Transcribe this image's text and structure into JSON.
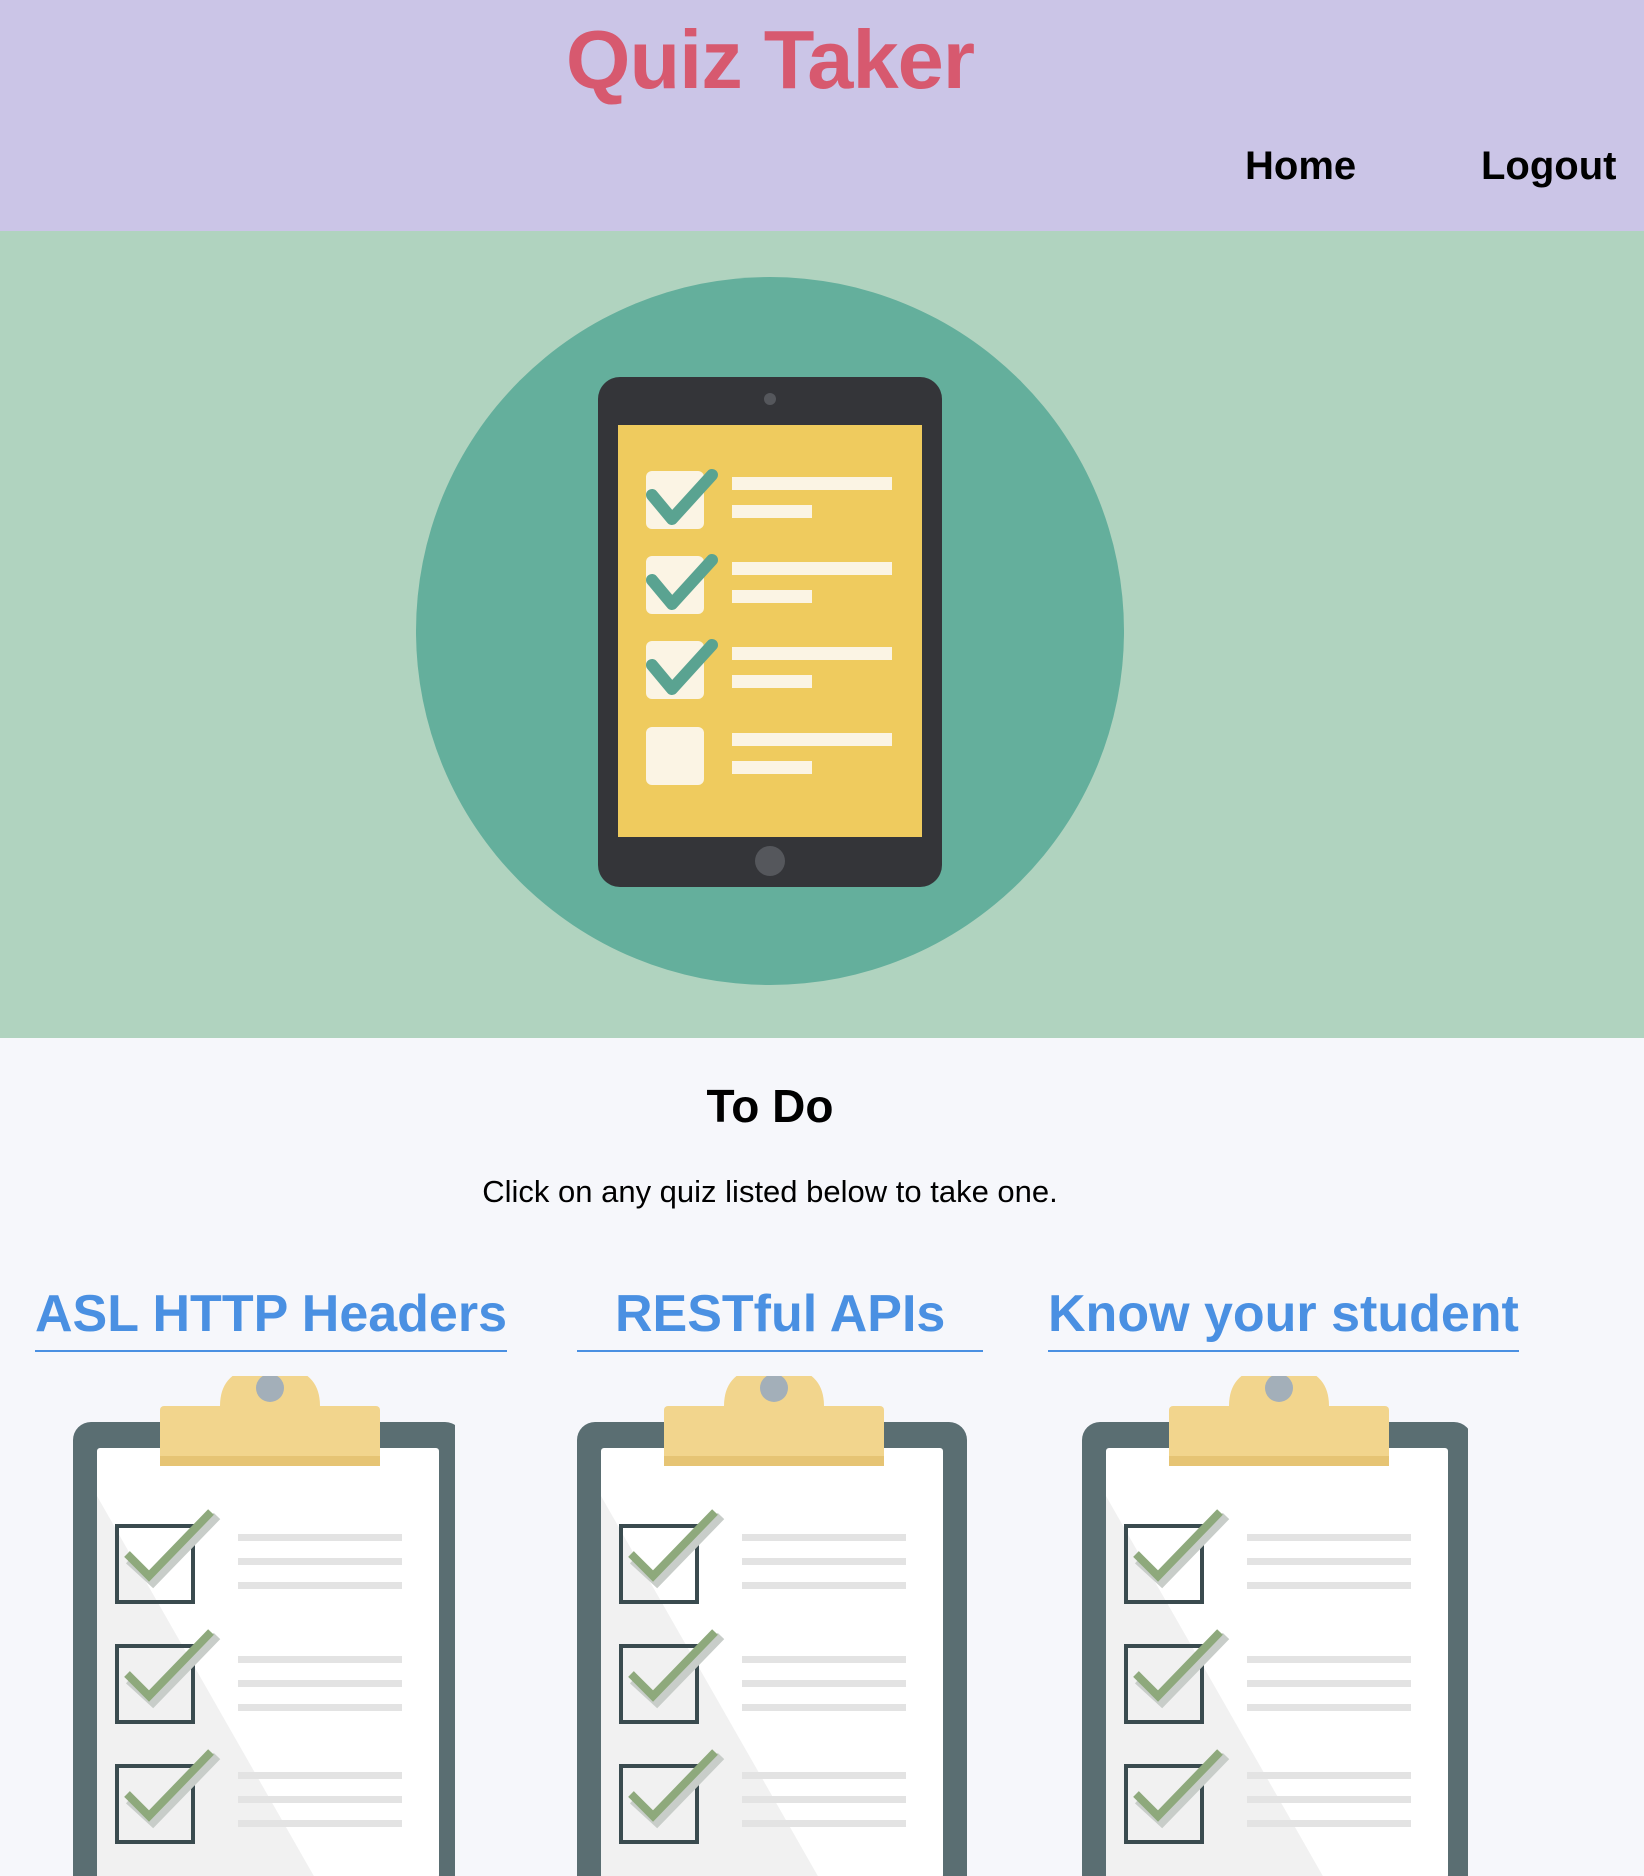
{
  "header": {
    "title": "Quiz Taker",
    "nav": [
      {
        "label": "Home"
      },
      {
        "label": "Logout"
      }
    ]
  },
  "colors": {
    "header_bg": "#cbc5e7",
    "title": "#d7596f",
    "hero_bg": "#b0d3bf",
    "hero_circle": "#64af9c",
    "tablet": "#343539",
    "tablet_screen": "#efcb5e",
    "link": "#4a90e2",
    "page_bg": "#f6f7fb"
  },
  "hero": {
    "icon": "tablet-checklist-icon",
    "checklist_checked": [
      true,
      true,
      true,
      false
    ]
  },
  "todo": {
    "title": "To Do",
    "description": "Click on any quiz listed below to take one."
  },
  "quizzes": [
    {
      "title": "ASL HTTP Headers",
      "icon": "clipboard-checklist-icon"
    },
    {
      "title": "RESTful APIs",
      "icon": "clipboard-checklist-icon"
    },
    {
      "title": "Know your student",
      "icon": "clipboard-checklist-icon"
    }
  ]
}
